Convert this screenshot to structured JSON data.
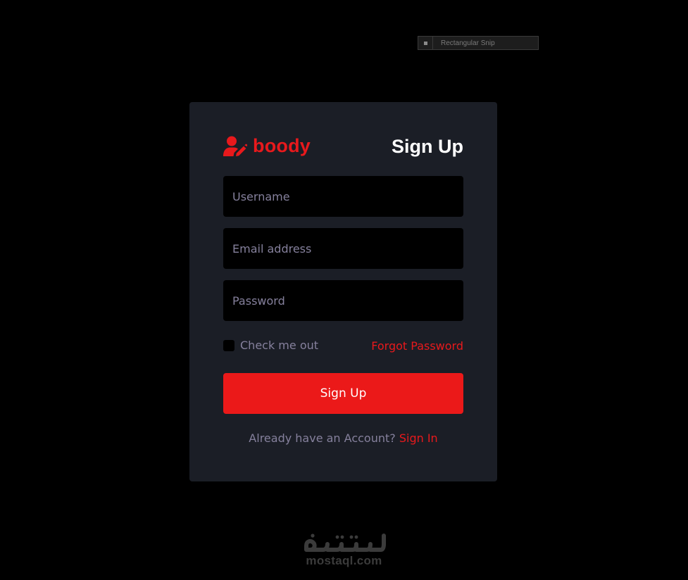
{
  "overlay": {
    "snip_label": "Rectangular Snip"
  },
  "brand": {
    "name": "boody",
    "icon": "user-edit-icon",
    "accent_color": "#e8191c"
  },
  "form": {
    "title": "Sign Up",
    "username_placeholder": "Username",
    "email_placeholder": "Email address",
    "password_placeholder": "Password",
    "remember_label": "Check me out",
    "forgot_link": "Forgot Password",
    "submit_label": "Sign Up",
    "signin_prompt": "Already have an Account?",
    "signin_link": "Sign In"
  },
  "watermark": {
    "logo_text": "مستقل",
    "url": "mostaql.com"
  },
  "colors": {
    "page_background": "#000000",
    "card_background": "#1b1e26",
    "button_background": "#eb1919",
    "muted_text": "#85809c"
  }
}
